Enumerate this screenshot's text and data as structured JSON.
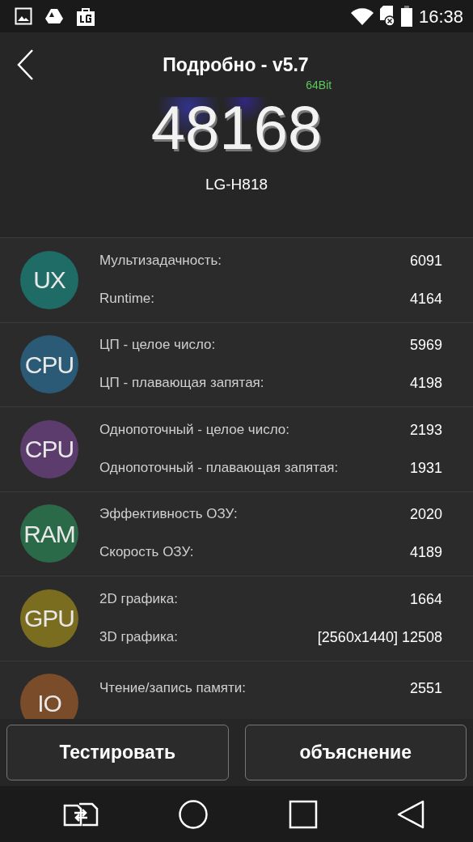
{
  "status_bar": {
    "time": "16:38"
  },
  "header": {
    "title": "Подробно - v5.7",
    "score": "48168",
    "bits": "64Bit",
    "device": "LG-H818"
  },
  "groups": [
    {
      "badge": "UX",
      "color": "#1f6b66",
      "items": [
        {
          "label": "Мультизадачность:",
          "value": "6091"
        },
        {
          "label": "Runtime:",
          "value": "4164"
        }
      ]
    },
    {
      "badge": "CPU",
      "color": "#2b5a77",
      "items": [
        {
          "label": "ЦП - целое число:",
          "value": "5969"
        },
        {
          "label": "ЦП - плавающая запятая:",
          "value": "4198"
        }
      ]
    },
    {
      "badge": "CPU",
      "color": "#5b3c6c",
      "items": [
        {
          "label": "Однопоточный - целое число:",
          "value": "2193"
        },
        {
          "label": "Однопоточный - плавающая запятая:",
          "value": "1931"
        }
      ]
    },
    {
      "badge": "RAM",
      "color": "#2b6a48",
      "items": [
        {
          "label": "Эффективность ОЗУ:",
          "value": "2020"
        },
        {
          "label": "Скорость ОЗУ:",
          "value": "4189"
        }
      ]
    },
    {
      "badge": "GPU",
      "color": "#7a6d1f",
      "items": [
        {
          "label": "2D графика:",
          "value": "1664"
        },
        {
          "label": "3D графика:",
          "value": "[2560x1440] 12508"
        }
      ]
    },
    {
      "badge": "IO",
      "color": "#7a4c2a",
      "items": [
        {
          "label": "Чтение/запись памяти:",
          "value": "2551"
        }
      ]
    }
  ],
  "buttons": [
    "Тестировать",
    "объяснение"
  ]
}
